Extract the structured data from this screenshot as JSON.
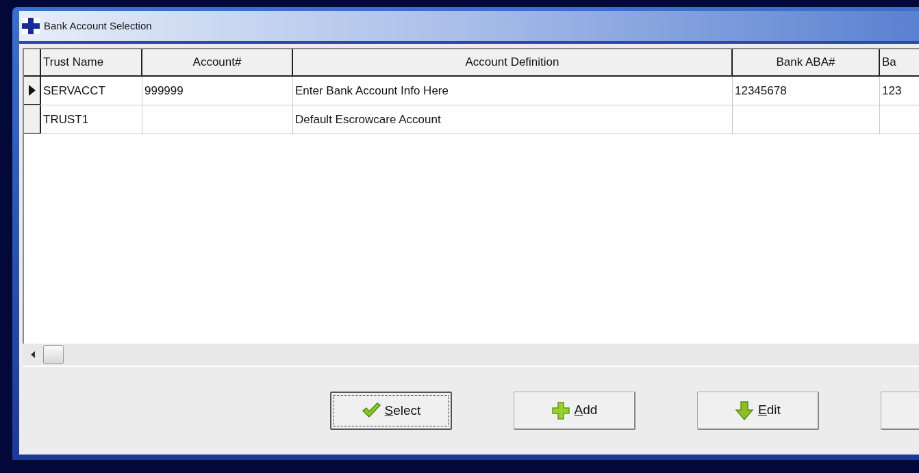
{
  "window": {
    "title": "Bank Account Selection"
  },
  "table": {
    "columns": [
      "Trust Name",
      "Account#",
      "Account Definition",
      "Bank ABA#",
      "Ba"
    ],
    "rows": [
      {
        "selected": true,
        "cells": [
          "SERVACCT",
          "999999",
          "Enter Bank Account Info Here",
          "12345678",
          "123"
        ]
      },
      {
        "selected": false,
        "cells": [
          "TRUST1",
          "",
          "Default Escrowcare Account",
          "",
          ""
        ]
      }
    ]
  },
  "buttons": [
    {
      "label": "Select",
      "kind": "check",
      "focused": true
    },
    {
      "label": "Add",
      "kind": "plus",
      "focused": false
    },
    {
      "label": "Edit",
      "kind": "down",
      "focused": false
    },
    {
      "kind": "blank",
      "focused": false
    }
  ]
}
